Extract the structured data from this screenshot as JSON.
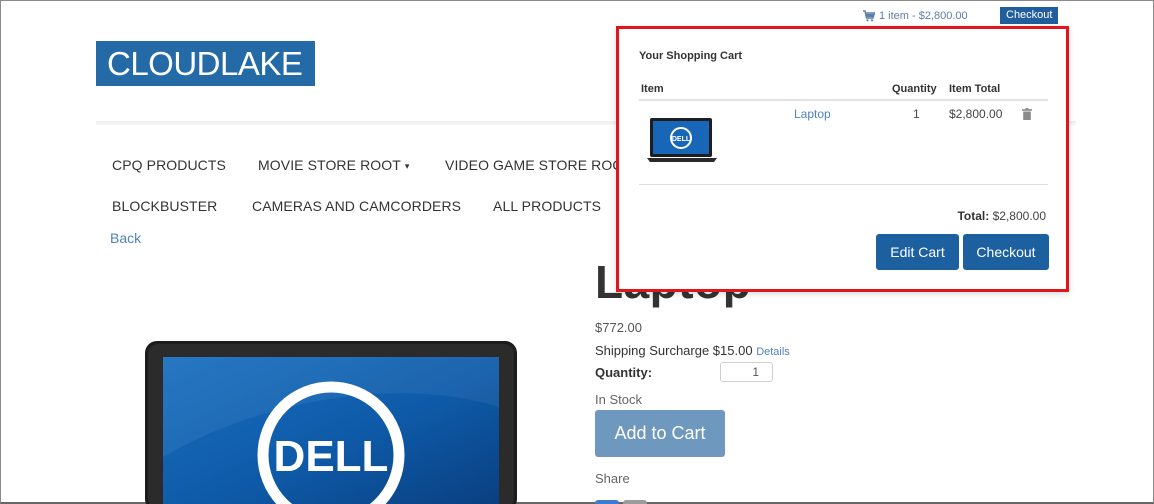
{
  "cart_summary": {
    "text": "1 item - $2,800.00",
    "checkout_label": "Checkout"
  },
  "brand": {
    "logo_text": "CLOUDLAKE",
    "color": "#246aa7"
  },
  "nav": {
    "row1": [
      "CPQ PRODUCTS",
      "MOVIE STORE ROOT",
      "VIDEO GAME STORE ROC"
    ],
    "row2": [
      "BLOCKBUSTER",
      "CAMERAS AND CAMCORDERS",
      "ALL PRODUCTS"
    ],
    "dropdown_caret": "▾",
    "back_label": "Back"
  },
  "product": {
    "title": "Laptop",
    "price": "$772.00",
    "shipping_label": "Shipping Surcharge $15.00",
    "details_label": "Details",
    "quantity_label": "Quantity:",
    "quantity_value": "1",
    "stock_status": "In Stock",
    "add_to_cart_label": "Add to Cart",
    "share_label": "Share",
    "image_logo_text": "DELL"
  },
  "cart_popup": {
    "title": "Your Shopping Cart",
    "columns": {
      "item": "Item",
      "quantity": "Quantity",
      "item_total": "Item Total"
    },
    "items": [
      {
        "name": "Laptop",
        "quantity": "1",
        "total": "$2,800.00",
        "thumb_logo_text": "DELL"
      }
    ],
    "total_label": "Total:",
    "total_value": "$2,800.00",
    "edit_cart_label": "Edit Cart",
    "checkout_label": "Checkout",
    "highlight_color": "#e0161c"
  },
  "colors": {
    "primary_button": "#1d60a0",
    "link": "#4d83bd",
    "add_to_cart": "#6f98be"
  }
}
